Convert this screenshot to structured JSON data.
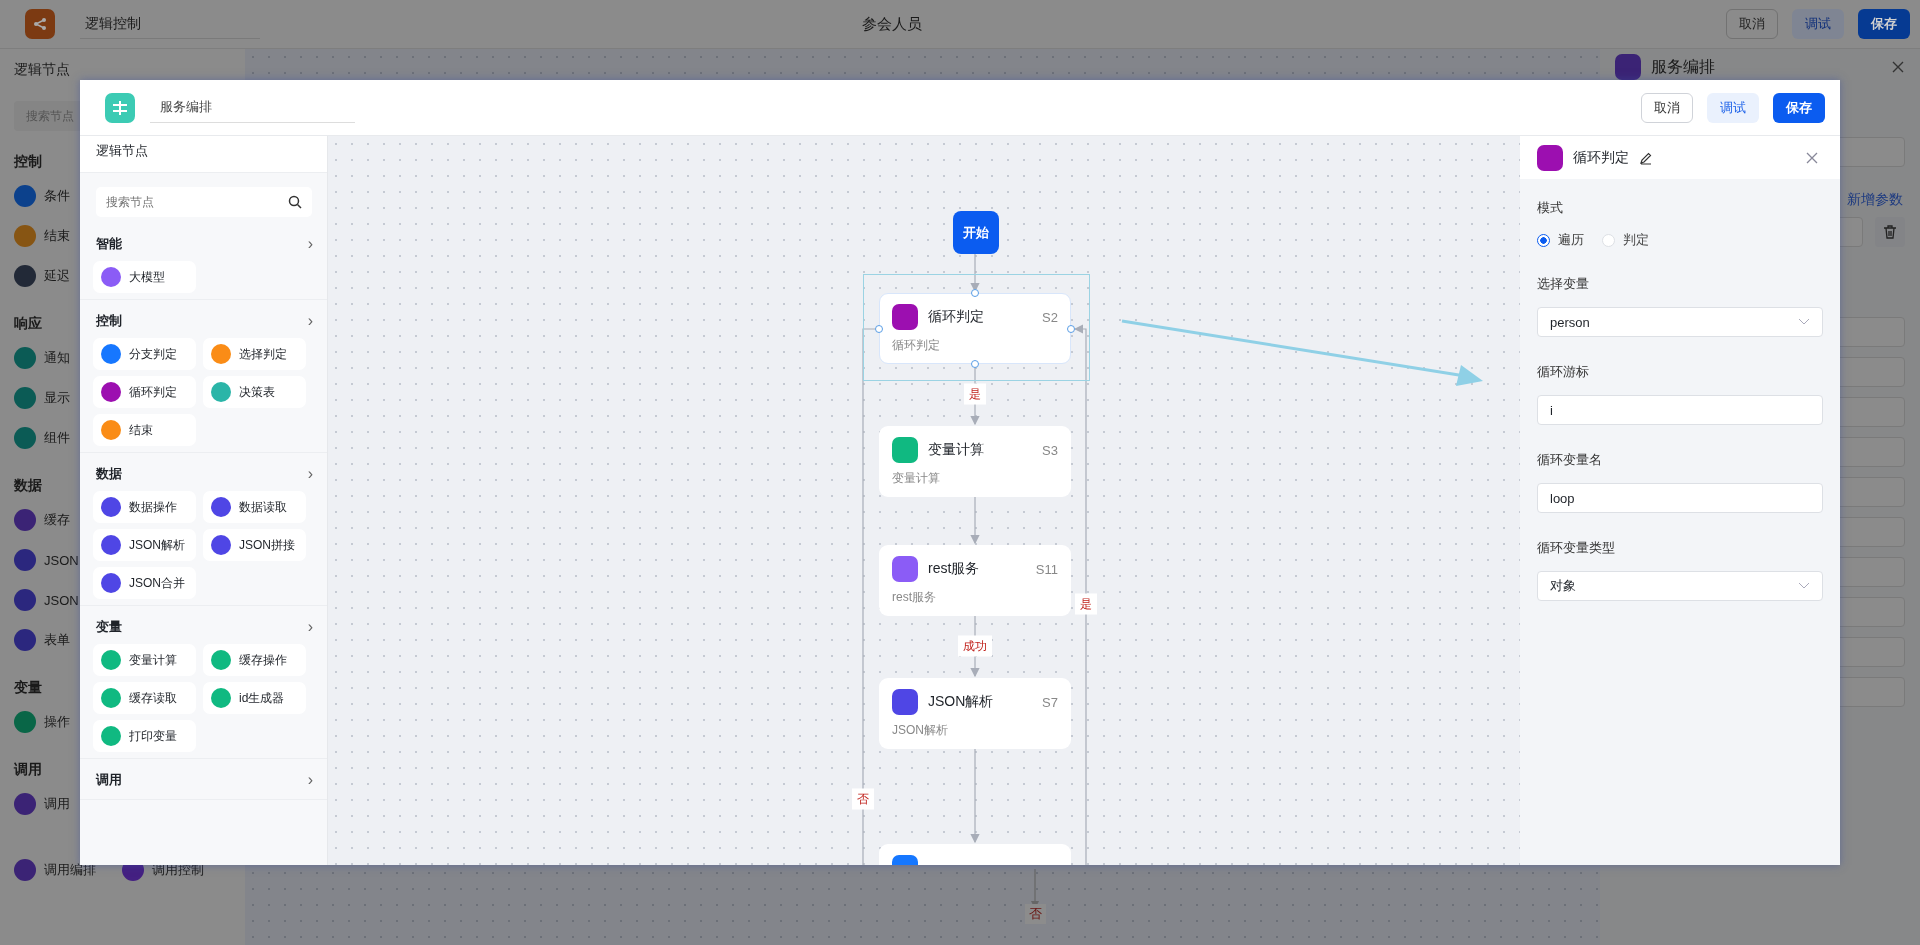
{
  "background": {
    "app_title": "逻辑控制",
    "page_title": "参会人员",
    "buttons": [
      {
        "label": "取消",
        "kind": "outline"
      },
      {
        "label": "调试",
        "kind": "light"
      },
      {
        "label": "保存",
        "kind": "primary"
      }
    ],
    "sidebar": {
      "title": "逻辑节点",
      "search_placeholder": "搜索节点",
      "sections": [
        {
          "title": "控制",
          "items": [
            {
              "label": "条件",
              "color": "#0c418c"
            },
            {
              "label": "结束",
              "color": "#875513"
            },
            {
              "label": "延迟",
              "color": "#222937"
            }
          ]
        },
        {
          "title": "响应",
          "items": [
            {
              "label": "通知",
              "color": "#0b5b55"
            },
            {
              "label": "显示",
              "color": "#0b5b55"
            },
            {
              "label": "组件",
              "color": "#0b5b55"
            }
          ]
        },
        {
          "title": "数据",
          "items": [
            {
              "label": "缓存",
              "color": "#3b2375"
            },
            {
              "label": "JSON",
              "color": "#2b277e"
            },
            {
              "label": "JSON",
              "color": "#2b277e"
            },
            {
              "label": "表单",
              "color": "#2b277e"
            }
          ]
        },
        {
          "title": "变量",
          "items": [
            {
              "label": "操作",
              "color": "#096647"
            }
          ]
        },
        {
          "title": "调用",
          "items": [
            {
              "label": "调用",
              "color": "#3b2375"
            }
          ]
        }
      ],
      "bottom_items": [
        {
          "label": "调用编排",
          "color": "#3b2375"
        },
        {
          "label": "调用控制",
          "color": "#442082"
        }
      ]
    },
    "edge_label": "否",
    "panel": {
      "title": "服务编排",
      "add_param": "新增参数"
    }
  },
  "modal": {
    "title": "服务编排",
    "buttons": [
      {
        "label": "取消",
        "kind": "outline"
      },
      {
        "label": "调试",
        "kind": "light"
      },
      {
        "label": "保存",
        "kind": "primary"
      }
    ],
    "sidebar": {
      "title": "逻辑节点",
      "search_placeholder": "搜索节点",
      "sections": [
        {
          "title": "智能",
          "chevron": "›",
          "items": [
            {
              "label": "大模型",
              "color": "#8b5cf6"
            }
          ]
        },
        {
          "title": "控制",
          "chevron": "›",
          "items": [
            {
              "label": "分支判定",
              "color": "#1677ff"
            },
            {
              "label": "选择判定",
              "color": "#fa8c16"
            },
            {
              "label": "循环判定",
              "color": "#9c0fb0"
            },
            {
              "label": "决策表",
              "color": "#2bb5a8"
            },
            {
              "label": "结束",
              "color": "#fa8c16"
            }
          ]
        },
        {
          "title": "数据",
          "chevron": "›",
          "items": [
            {
              "label": "数据操作",
              "color": "#4f46e5"
            },
            {
              "label": "数据读取",
              "color": "#4f46e5"
            },
            {
              "label": "JSON解析",
              "color": "#4f46e5"
            },
            {
              "label": "JSON拼接",
              "color": "#4f46e5"
            },
            {
              "label": "JSON合并",
              "color": "#4f46e5"
            }
          ]
        },
        {
          "title": "变量",
          "chevron": "›",
          "items": [
            {
              "label": "变量计算",
              "color": "#10b981"
            },
            {
              "label": "缓存操作",
              "color": "#10b981"
            },
            {
              "label": "缓存读取",
              "color": "#10b981"
            },
            {
              "label": "id生成器",
              "color": "#10b981"
            },
            {
              "label": "打印变量",
              "color": "#10b981"
            }
          ]
        },
        {
          "title": "调用",
          "chevron": "›"
        }
      ]
    },
    "flow": {
      "start": "开始",
      "nodes": [
        {
          "title": "循环判定",
          "id": "S2",
          "desc": "循环判定",
          "color": "#9c0fb0",
          "selected": true
        },
        {
          "title": "变量计算",
          "id": "S3",
          "desc": "变量计算",
          "color": "#10b981",
          "selected": false
        },
        {
          "title": "rest服务",
          "id": "S11",
          "desc": "rest服务",
          "color": "#8b5cf6",
          "selected": false
        },
        {
          "title": "JSON解析",
          "id": "S7",
          "desc": "JSON解析",
          "color": "#4f46e5",
          "selected": false
        },
        {
          "color": "#1677ff",
          "selected": false
        }
      ],
      "edge_labels": [
        {
          "text": "是"
        },
        {
          "text": "成功"
        },
        {
          "text": "否"
        },
        {
          "text": "是"
        }
      ]
    },
    "config": {
      "title": "循环判定",
      "color": "#9c0fb0",
      "fields": [
        {
          "kind": "radio",
          "label": "模式",
          "options": [
            {
              "label": "遍历",
              "selected": true
            },
            {
              "label": "判定",
              "selected": false
            }
          ]
        },
        {
          "kind": "select",
          "label": "选择变量",
          "value": "person"
        },
        {
          "kind": "input",
          "label": "循环游标",
          "value": "i"
        },
        {
          "kind": "input",
          "label": "循环变量名",
          "value": "loop"
        },
        {
          "kind": "select",
          "label": "循环变量类型",
          "value": "对象"
        }
      ]
    }
  }
}
